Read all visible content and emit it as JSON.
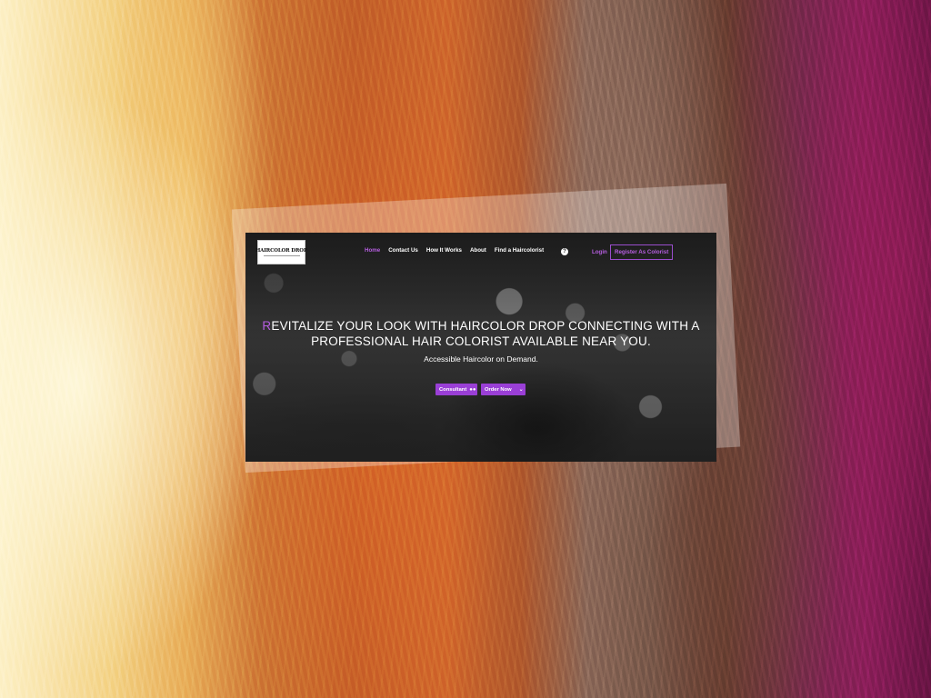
{
  "logo": {
    "text": "HAIRCOLOR DROP"
  },
  "nav": {
    "items": [
      "Home",
      "Contact Us",
      "How It Works",
      "About",
      "Find a Haircolorist"
    ],
    "active": "Home",
    "help_icon": "?",
    "login": "Login",
    "register": "Register As Colorist"
  },
  "hero": {
    "title_first_letter": "R",
    "title_rest_line1": "EVITALIZE YOUR LOOK WITH HAIRCOLOR DROP CONNECTING WITH A",
    "title_line2": "PROFESSIONAL HAIR COLORIST AVAILABLE NEAR YOU.",
    "subtitle": "Accessible Haircolor on Demand."
  },
  "buttons": {
    "consultant": "Consultant",
    "consultant_icon": "people-icon",
    "order": "Order Now",
    "order_icon": "chevron-down-icon"
  },
  "colors": {
    "accent": "#b65ee0",
    "button": "#9a3fd6"
  }
}
